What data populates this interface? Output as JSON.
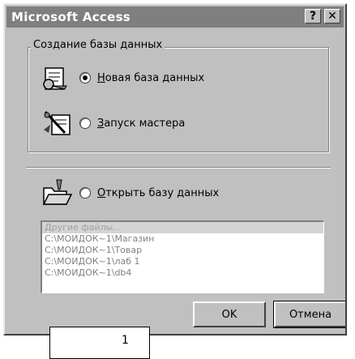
{
  "window": {
    "title": "Microsoft Access",
    "help_label": "?",
    "close_label": "✕"
  },
  "create_group": {
    "legend": "Создание базы данных",
    "new_db": {
      "prefix_accel": "Н",
      "label_rest": "овая база данных",
      "checked": true,
      "icon": "new-database-icon"
    },
    "wizard": {
      "prefix_accel": "З",
      "label_rest": "апуск мастера",
      "checked": false,
      "icon": "wizard-icon"
    }
  },
  "open_group": {
    "open_db": {
      "prefix_accel": "О",
      "label_rest": "ткрыть базу данных",
      "checked": false,
      "icon": "open-folder-icon"
    },
    "files": [
      "Другие файлы...",
      "C:\\МОИДОК~1\\Магазин",
      "C:\\МОИДОК~1\\Товар",
      "C:\\МОИДОК~1\\лаб 1",
      "C:\\МОИДОК~1\\db4"
    ]
  },
  "buttons": {
    "ok": "OK",
    "cancel": "Отмена"
  },
  "overlay": {
    "text": "1"
  }
}
